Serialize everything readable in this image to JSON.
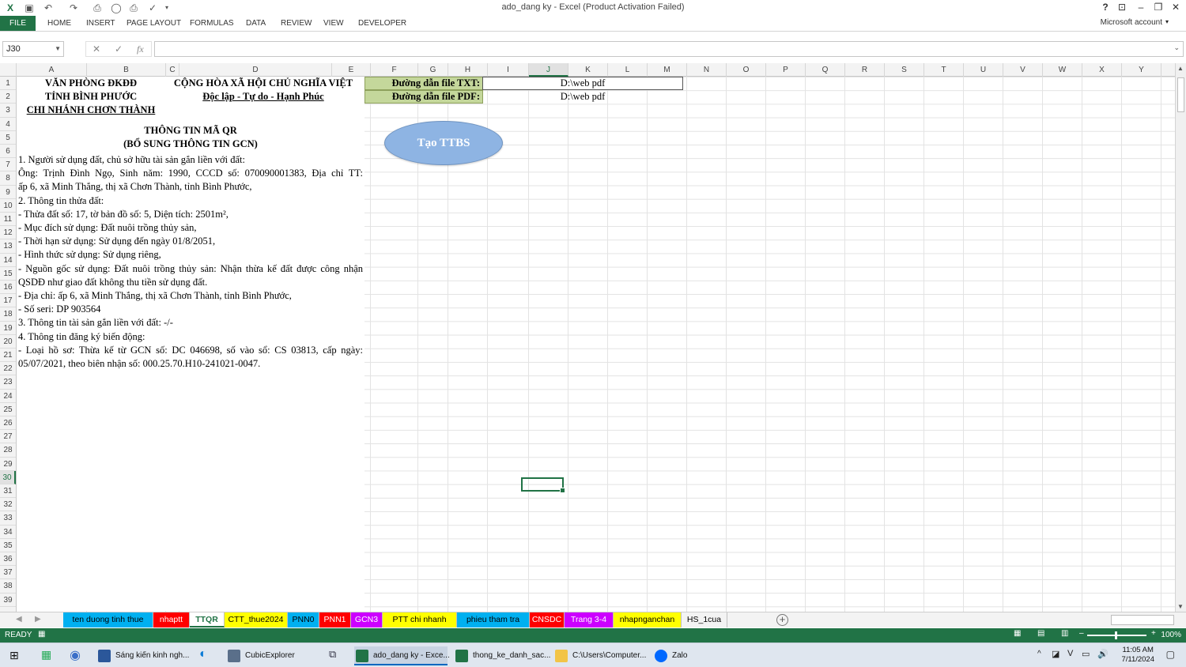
{
  "window": {
    "title": "ado_dang ky - Excel (Product Activation Failed)",
    "account": "Microsoft account"
  },
  "ribbon": {
    "tabs": [
      "FILE",
      "HOME",
      "INSERT",
      "PAGE LAYOUT",
      "FORMULAS",
      "DATA",
      "REVIEW",
      "VIEW",
      "DEVELOPER"
    ]
  },
  "formula": {
    "namebox": "J30",
    "fx": "fx",
    "value": ""
  },
  "columns": [
    "A",
    "B",
    "C",
    "D",
    "E",
    "F",
    "G",
    "H",
    "I",
    "J",
    "K",
    "L",
    "M",
    "N",
    "O",
    "P",
    "Q",
    "R",
    "S",
    "T",
    "U",
    "V",
    "W",
    "X",
    "Y"
  ],
  "rows": [
    "1",
    "2",
    "3",
    "4",
    "5",
    "6",
    "7",
    "8",
    "9",
    "10",
    "11",
    "12",
    "13",
    "14",
    "15",
    "16",
    "17",
    "18",
    "19",
    "20",
    "21",
    "22",
    "23",
    "24",
    "25",
    "26",
    "27",
    "28",
    "29",
    "30",
    "31",
    "32",
    "33",
    "34",
    "35",
    "36",
    "37",
    "38",
    "39"
  ],
  "header": {
    "office1": "VĂN PHÒNG ĐKĐĐ",
    "office2": "TỈNH BÌNH PHƯỚC",
    "office3": "CHI NHÁNH CHƠN THÀNH",
    "nation1": "CỘNG HÒA XÃ HỘI CHỦ NGHĨA VIỆT",
    "nation2": "Độc lập - Tự do - Hạnh Phúc",
    "txt_label": "Đường dẫn file TXT:",
    "pdf_label": "Đường dẫn file PDF:",
    "txt_path": "D:\\web pdf",
    "pdf_path": "D:\\web pdf"
  },
  "qr": {
    "title": "THÔNG TIN MÃ QR",
    "subtitle": "(BỔ SUNG THÔNG TIN GCN)"
  },
  "lines": [
    "1. Người sử dụng đất, chủ sở hữu tài sản gắn liền với đất:",
    "   Ông: Trịnh Đình Ngọ, Sinh năm: 1990, CCCD số: 070090001383, Địa chỉ TT:",
    "ấp 6, xã Minh Thắng, thị xã Chơn Thành, tỉnh Bình Phước,",
    "2. Thông tin thửa đất:",
    "- Thửa đất số: 17, tờ bản đồ số: 5, Diện tích: 2501m²,",
    "- Mục đích sử dụng: Đất nuôi trồng thủy sản,",
    "- Thời hạn sử dụng:  Sử dụng đến ngày 01/8/2051,",
    "- Hình thức sử dụng: Sử dụng riêng,",
    "- Nguồn gốc sử dụng: Đất nuôi trồng thủy sản: Nhận thừa kế đất được công nhận",
    "QSDĐ như giao đất không thu tiền sử dụng đất.",
    "- Địa chỉ: ấp 6, xã Minh Thắng, thị xã Chơn Thành, tỉnh Bình Phước,",
    "- Số seri: DP 903564",
    "3. Thông tin tài sản gắn liền với đất: -/-",
    "4. Thông tin đăng ký biến động:",
    "- Loại hồ sơ: Thừa kế từ GCN số: DC 046698, số vào sổ: CS 03813, cấp ngày:",
    "05/07/2021, theo biên nhận số: 000.25.70.H10-241021-0047."
  ],
  "button": {
    "label": "Tạo TTBS"
  },
  "sheets": [
    {
      "name": "ten duong tinh thue",
      "color": "#00b0f0"
    },
    {
      "name": "nhaptt",
      "color": "#ff0000"
    },
    {
      "name": "TTQR",
      "color": "#ffffff"
    },
    {
      "name": "CTT_thue2024",
      "color": "#ffff00"
    },
    {
      "name": "PNN0",
      "color": "#00b0f0"
    },
    {
      "name": "PNN1",
      "color": "#ff0000"
    },
    {
      "name": "GCN3",
      "color": "#cc00ff"
    },
    {
      "name": "PTT chi nhanh",
      "color": "#ffff00"
    },
    {
      "name": "phieu tham tra",
      "color": "#00b0f0"
    },
    {
      "name": "CNSDC",
      "color": "#ff0000"
    },
    {
      "name": "Trang 3-4",
      "color": "#cc00ff"
    },
    {
      "name": "nhapnganchan",
      "color": "#ffff00"
    },
    {
      "name": "HS_1cua",
      "color": "#f3f3f3"
    }
  ],
  "status": {
    "ready": "READY",
    "zoom": "100%"
  },
  "taskbar": {
    "items": [
      "Sáng kiến kinh ngh...",
      "CubicExplorer",
      "ado_dang ky - Exce...",
      "thong_ke_danh_sac...",
      "C:\\Users\\Computer...",
      "Zalo"
    ],
    "time": "11:05 AM",
    "date": "7/11/2024"
  }
}
